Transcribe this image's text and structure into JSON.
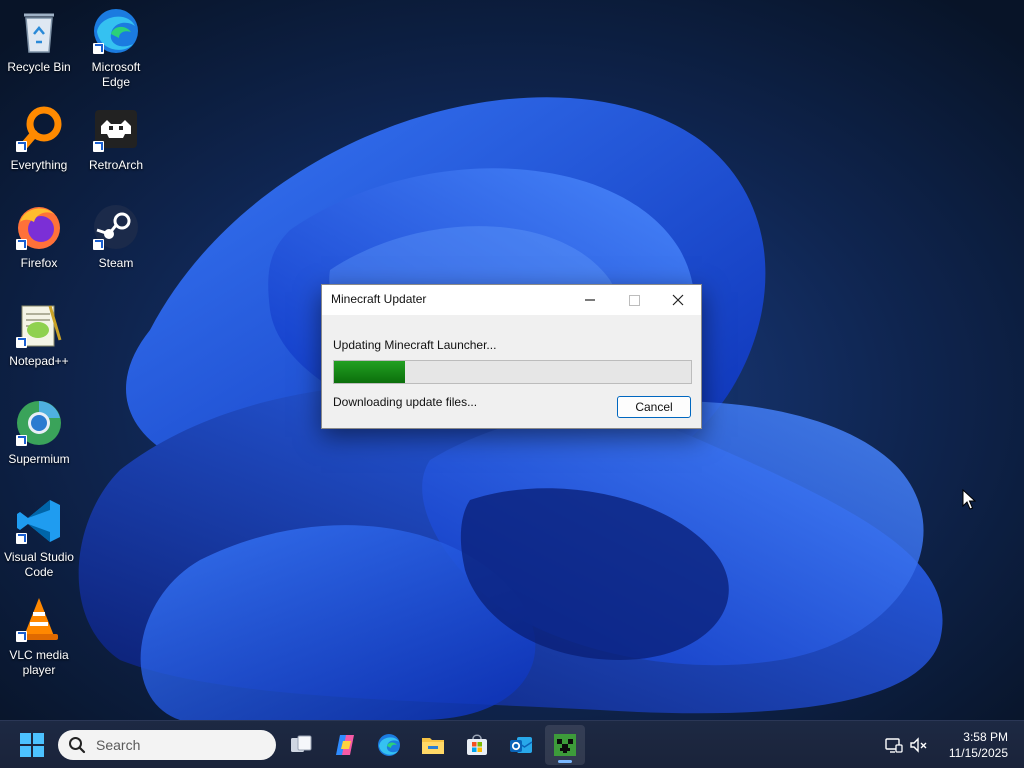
{
  "desktop": {
    "icons": [
      {
        "label": "Recycle Bin",
        "icon": "recycle-bin-icon"
      },
      {
        "label": "Microsoft Edge",
        "icon": "edge-icon"
      },
      {
        "label": "Everything",
        "icon": "everything-search-icon"
      },
      {
        "label": "RetroArch",
        "icon": "retroarch-icon"
      },
      {
        "label": "Firefox",
        "icon": "firefox-icon"
      },
      {
        "label": "Steam",
        "icon": "steam-icon"
      },
      {
        "label": "Notepad++",
        "icon": "notepad-plus-plus-icon"
      },
      {
        "label": "Supermium",
        "icon": "supermium-icon"
      },
      {
        "label": "Visual Studio Code",
        "icon": "vscode-icon"
      },
      {
        "label": "VLC media player",
        "icon": "vlc-icon"
      }
    ]
  },
  "dialog": {
    "title": "Minecraft Updater",
    "status": "Updating Minecraft Launcher...",
    "progress": 0.2,
    "progress_color": "#1f8a1f",
    "substatus": "Downloading update files...",
    "cancel_label": "Cancel"
  },
  "taskbar": {
    "search_placeholder": "Search",
    "apps": [
      "start-icon",
      "task-view-icon",
      "copilot-icon",
      "edge-icon",
      "file-explorer-icon",
      "microsoft-store-icon",
      "outlook-icon",
      "minecraft-icon"
    ],
    "active_app": "minecraft-icon",
    "tray": [
      "network-icon",
      "volume-muted-icon"
    ],
    "time": "3:58 PM",
    "date": "11/15/2025"
  }
}
